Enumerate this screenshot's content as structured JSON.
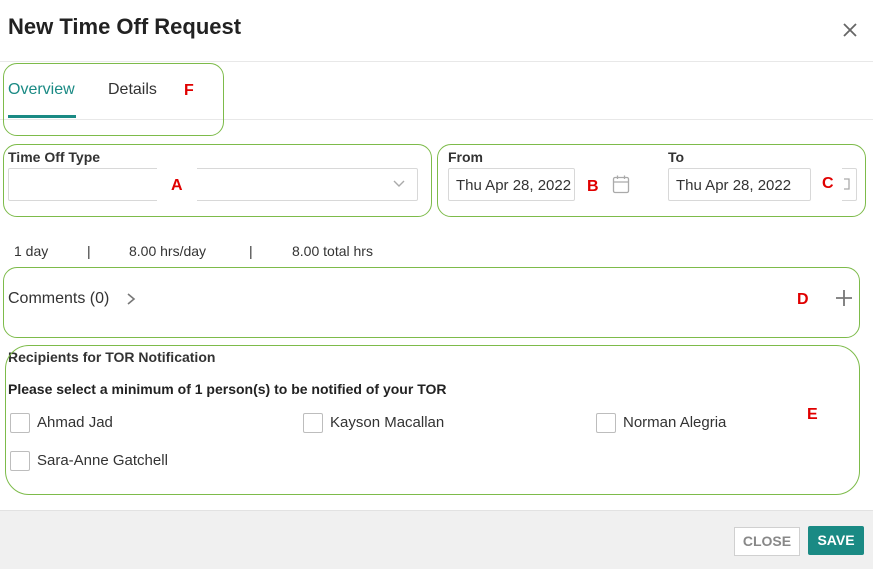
{
  "dialog": {
    "title": "New Time Off Request",
    "close_icon": "close-icon"
  },
  "tabs": [
    {
      "label": "Overview",
      "active": true
    },
    {
      "label": "Details",
      "active": false
    }
  ],
  "form": {
    "time_off_type": {
      "label": "Time Off Type",
      "value": ""
    },
    "from": {
      "label": "From",
      "value": "Thu Apr 28, 2022"
    },
    "to": {
      "label": "To",
      "value": "Thu Apr 28, 2022"
    }
  },
  "summary": {
    "days": "1 day",
    "sep1": "|",
    "hrs_per_day": "8.00 hrs/day",
    "sep2": "|",
    "total_hrs": "8.00 total hrs"
  },
  "comments": {
    "label": "Comments (0)"
  },
  "recipients": {
    "heading": "Recipients for TOR Notification",
    "instruction": "Please select a minimum of 1 person(s) to be notified of your TOR",
    "people": [
      {
        "name": "Ahmad Jad",
        "checked": false
      },
      {
        "name": "Kayson Macallan",
        "checked": false
      },
      {
        "name": "Norman Alegria",
        "checked": false
      },
      {
        "name": "Sara-Anne Gatchell",
        "checked": false
      }
    ]
  },
  "annotations": {
    "a": "A",
    "b": "B",
    "c": "C",
    "d": "D",
    "e": "E",
    "f": "F"
  },
  "footer": {
    "close_label": "CLOSE",
    "save_label": "SAVE"
  },
  "colors": {
    "accent": "#1a8a84",
    "annotation_border": "#7dbb4a",
    "annotation_letter": "#e00000"
  }
}
